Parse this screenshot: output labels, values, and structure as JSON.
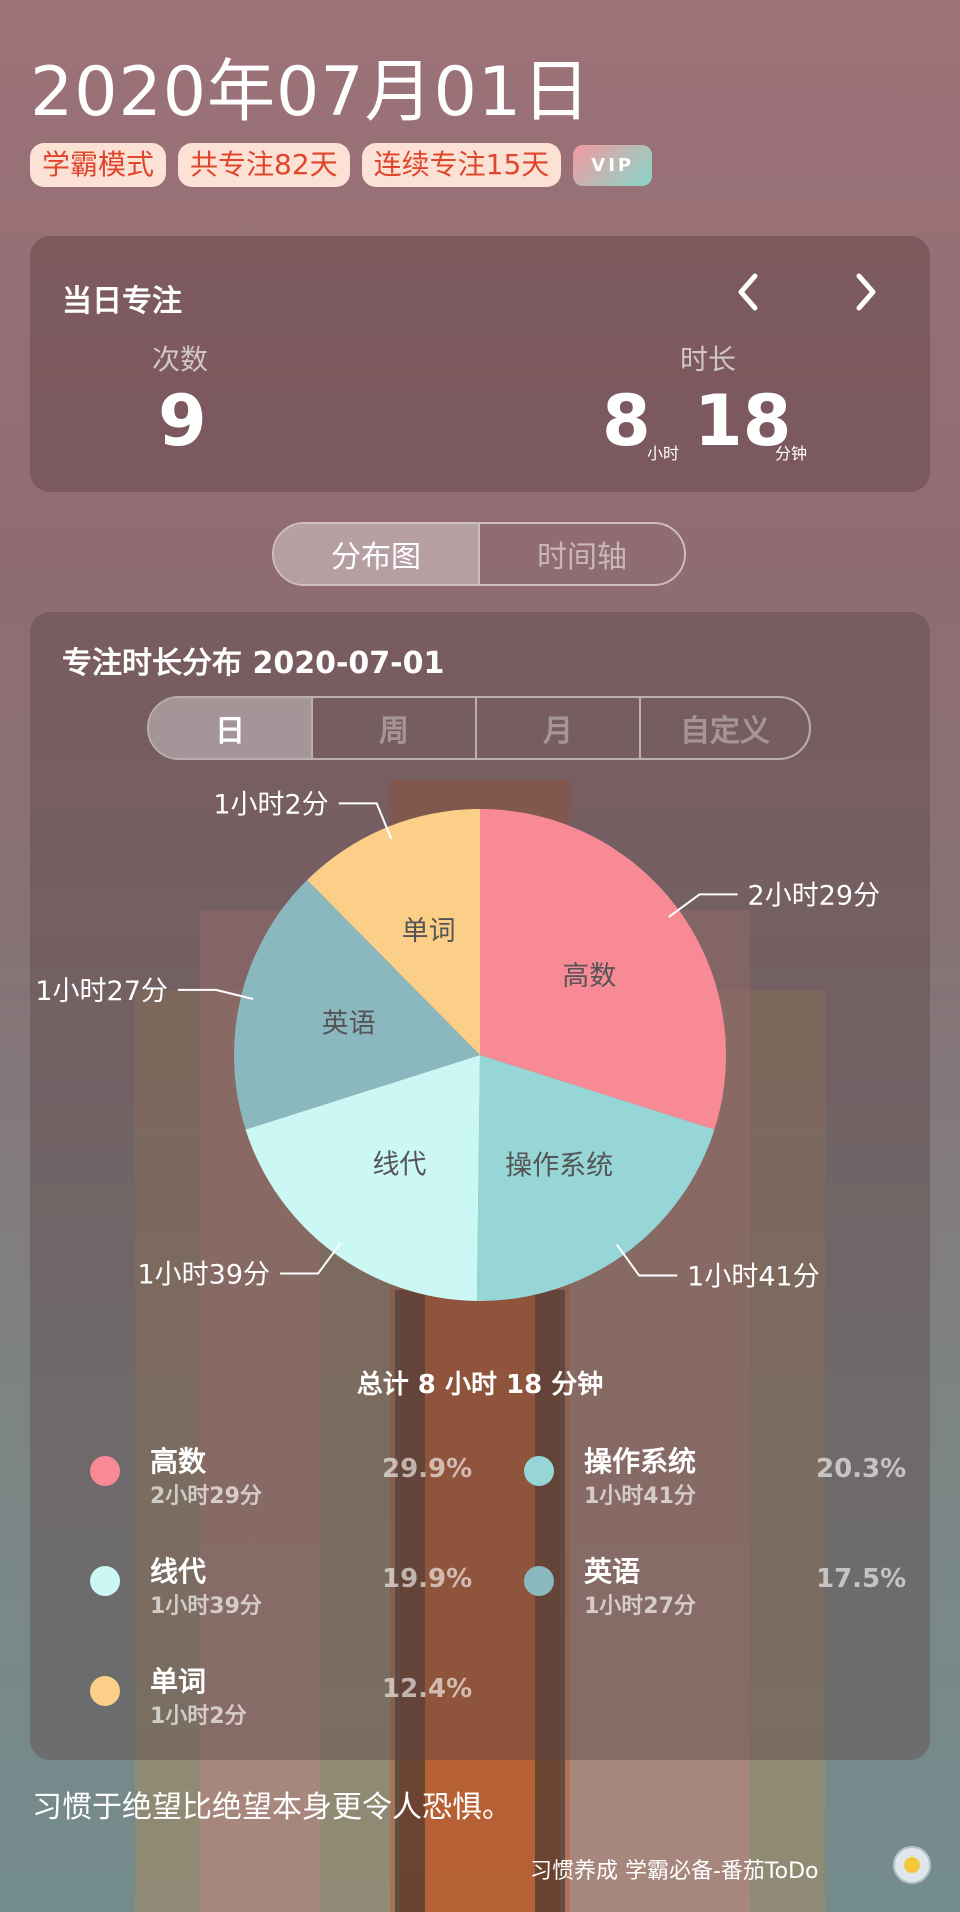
{
  "header": {
    "date_title": "2020年07月01日",
    "tags": [
      "学霸模式",
      "共专注82天",
      "连续专注15天"
    ],
    "vip_label": "VIP"
  },
  "today": {
    "title": "当日专注",
    "count_label": "次数",
    "count_value": "9",
    "duration_label": "时长",
    "hours": "8",
    "hours_unit": "小时",
    "minutes": "18",
    "minutes_unit": "分钟",
    "prev_icon": "chevron-left-icon",
    "next_icon": "chevron-right-icon"
  },
  "view_switch": {
    "tabs": [
      "分布图",
      "时间轴"
    ],
    "active": "分布图"
  },
  "distribution": {
    "title": "专注时长分布  2020-07-01",
    "range_tabs": [
      "日",
      "周",
      "月",
      "自定义"
    ],
    "active_range": "日",
    "total_text": "总计 8 小时 18 分钟"
  },
  "chart_data": {
    "type": "pie",
    "series": [
      {
        "name": "高数",
        "duration": "2小时29分",
        "percent": 29.9,
        "color": "#f88a96"
      },
      {
        "name": "操作系统",
        "duration": "1小时41分",
        "percent": 20.3,
        "color": "#96d6d7"
      },
      {
        "name": "线代",
        "duration": "1小时39分",
        "percent": 19.9,
        "color": "#cbf7f4"
      },
      {
        "name": "英语",
        "duration": "1小时27分",
        "percent": 17.5,
        "color": "#8bb8bf"
      },
      {
        "name": "单词",
        "duration": "1小时2分",
        "percent": 12.4,
        "color": "#fccf88"
      }
    ]
  },
  "legend": [
    {
      "name": "高数",
      "duration": "2小时29分",
      "percent": "29.9%",
      "color": "#f88a96"
    },
    {
      "name": "操作系统",
      "duration": "1小时41分",
      "percent": "20.3%",
      "color": "#96d6d7"
    },
    {
      "name": "线代",
      "duration": "1小时39分",
      "percent": "19.9%",
      "color": "#cbf7f4"
    },
    {
      "name": "英语",
      "duration": "1小时27分",
      "percent": "17.5%",
      "color": "#8bb8bf"
    },
    {
      "name": "单词",
      "duration": "1小时2分",
      "percent": "12.4%",
      "color": "#fccf88"
    }
  ],
  "footer": {
    "quote": "习惯于绝望比绝望本身更令人恐惧。",
    "app_text": "习惯养成 学霸必备-番茄ToDo",
    "logo_icon": "tomato-logo-icon"
  }
}
